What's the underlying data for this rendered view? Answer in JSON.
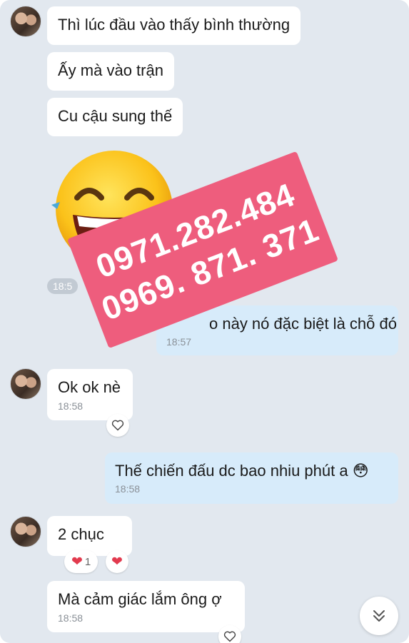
{
  "messages": [
    {
      "text": "Thì lúc đầu vào thấy bình thường"
    },
    {
      "text": "Ấy mà vào trận"
    },
    {
      "text": "Cu cậu sung thế"
    },
    {
      "sticker": "laughing-emoji",
      "time": "18:5"
    },
    {
      "text": "o này nó đặc biệt là chỗ đó",
      "time": "18:57"
    },
    {
      "text": "Ok ok nè",
      "time": "18:58"
    },
    {
      "text": "Thế chiến đấu dc bao nhiu phút a",
      "emoji": "😳",
      "time": "18:58"
    },
    {
      "text": "2 chục",
      "reaction_count": "1"
    },
    {
      "text": "Mà cảm giác lắm ông ợ",
      "time": "18:58"
    }
  ],
  "watermark": {
    "line1": "0971.282.484",
    "line2": "0969. 871. 371",
    "color": "#ee5d7d"
  },
  "colors": {
    "background": "#e2e8ef",
    "incoming_bubble": "#ffffff",
    "outgoing_bubble": "#d7ebfa",
    "heart": "#e23a4e"
  },
  "icons": {
    "reaction": "heart-outline-icon",
    "scroll_down": "double-chevron-down-icon"
  }
}
